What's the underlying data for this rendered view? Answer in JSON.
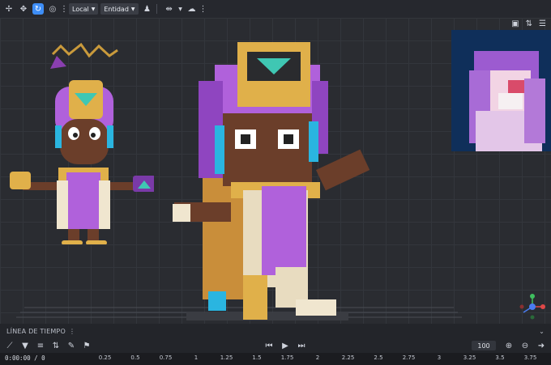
{
  "toolbar": {
    "space_dropdown": "Local",
    "entity_dropdown": "Entidad"
  },
  "timeline": {
    "title": "LÍNEA DE TIEMPO",
    "fps_value": "100",
    "current_time": "0:00:00",
    "time_sep": "/",
    "total_frames": "0",
    "ruler_ticks": [
      "0.25",
      "0.5",
      "0.75",
      "1",
      "1.25",
      "1.5",
      "1.75",
      "2",
      "2.25",
      "2.5",
      "2.75",
      "3",
      "3.25",
      "3.5",
      "3.75"
    ]
  },
  "colors": {
    "accent": "#3e8ef7",
    "purple": "#b05ad6",
    "gold": "#d9a743",
    "skin": "#6b3e2a"
  }
}
